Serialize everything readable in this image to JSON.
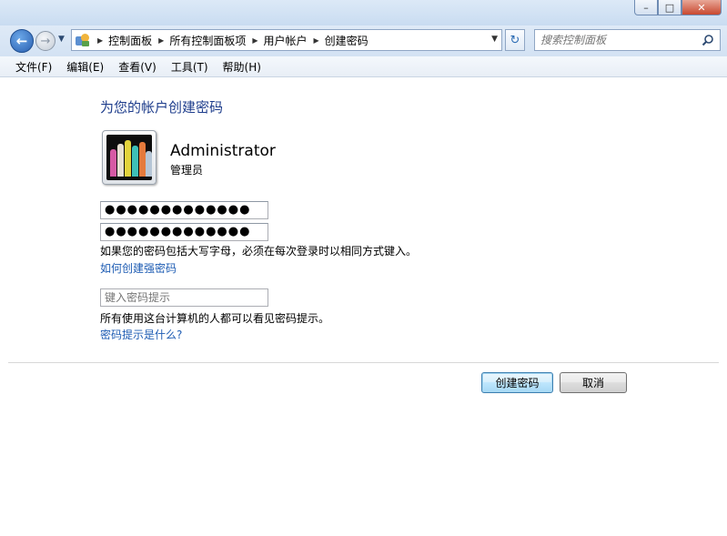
{
  "window": {
    "caption_buttons": {
      "minimize": "–",
      "maximize": "□",
      "close": "✕"
    }
  },
  "nav": {
    "back_icon": "back-arrow-icon",
    "forward_icon": "forward-arrow-icon"
  },
  "address": {
    "breadcrumbs": [
      "控制面板",
      "所有控制面板项",
      "用户帐户",
      "创建密码"
    ]
  },
  "search": {
    "placeholder": "搜索控制面板"
  },
  "menu": {
    "items": [
      "文件(F)",
      "编辑(E)",
      "查看(V)",
      "工具(T)",
      "帮助(H)"
    ]
  },
  "main": {
    "title": "为您的帐户创建密码",
    "user": {
      "name": "Administrator",
      "role": "管理员"
    },
    "new_password_masked": "●●●●●●●●●●●●●",
    "confirm_password_masked": "●●●●●●●●●●●●●",
    "caps_note": "如果您的密码包括大写字母，必须在每次登录时以相同方式键入。",
    "strong_password_link": "如何创建强密码",
    "hint_placeholder": "键入密码提示",
    "hint_note": "所有使用这台计算机的人都可以看见密码提示。",
    "hint_link": "密码提示是什么?"
  },
  "buttons": {
    "create": "创建密码",
    "cancel": "取消"
  },
  "colors": {
    "title": "#1e3d8c",
    "link": "#1e5cb3",
    "accent": "#3c7fb1"
  }
}
